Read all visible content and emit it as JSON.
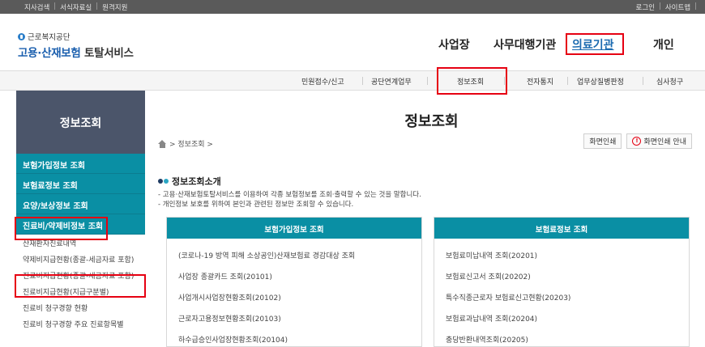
{
  "topbar": {
    "left": [
      "지사검색",
      "서식자료실",
      "원격지원"
    ],
    "right": [
      "로그인",
      "사이트맵"
    ],
    "sep": "|"
  },
  "logo": {
    "org": "근로복지공단",
    "title_blue": "고용·산재보험",
    "title_rest": " 토탈서비스"
  },
  "mainnav": {
    "items": [
      "사업장",
      "사무대행기관",
      "의료기관",
      "개인"
    ],
    "active": "의료기관"
  },
  "subnav": {
    "items": [
      "민원접수/신고",
      "공단연계업무",
      "정보조회",
      "전자통지",
      "업무상질병판정",
      "심사청구"
    ],
    "active": "정보조회"
  },
  "sidebar": {
    "title": "정보조회",
    "categories": [
      "보험가입정보 조회",
      "보험료정보 조회",
      "요양/보상정보 조회",
      "진료비/약제비정보 조회"
    ],
    "subs": [
      "산재환자진료내역",
      "약제비지급현황(종괄-세금자료 포함)",
      "진료비지급현황(종괄-세금자료 포함)",
      "진료비지급현황(지급구분별)",
      "진료비 청구경향 현황",
      "진료비 청구경향 주요 진료항목별"
    ]
  },
  "content": {
    "title": "정보조회",
    "breadcrumb": "> 정보조회 >",
    "print_button": "화면인쇄",
    "print_guide_button": "화면인쇄 안내",
    "alert_glyph": "!",
    "intro_title": "정보조회소개",
    "intro_lines": [
      "- 고용·산재보험토탈서비스를 이용하여 각종 보험정보를 조회·출력할 수 있는 것을 말합니다.",
      "- 개인정보 보호를 위하여 본인과 관련된 정보만 조회할 수 있습니다."
    ],
    "panels": [
      {
        "header": "보험가입정보 조회",
        "items": [
          "(코로나-19 방역 피해 소상공인)산재보험료 경감대상 조회",
          "사업장 종괄카드 조회(20101)",
          "사업개시사업장현황조회(20102)",
          "근로자고용정보현황조회(20103)",
          "하수급승인사업장현황조회(20104)"
        ]
      },
      {
        "header": "보험료정보 조회",
        "items": [
          "보험료미납내역 조회(20201)",
          "보험료신고서 조회(20202)",
          "특수직종근로자 보험료신고현황(20203)",
          "보험료과납내역 조회(20204)",
          "충당반환내역조회(20205)"
        ]
      }
    ]
  },
  "colors": {
    "teal": "#0a8fa4",
    "sidebar_head": "#4b556a",
    "highlight_red": "#e60012",
    "dot_dark": "#1f3b63",
    "dot_teal": "#2aa6c4"
  }
}
